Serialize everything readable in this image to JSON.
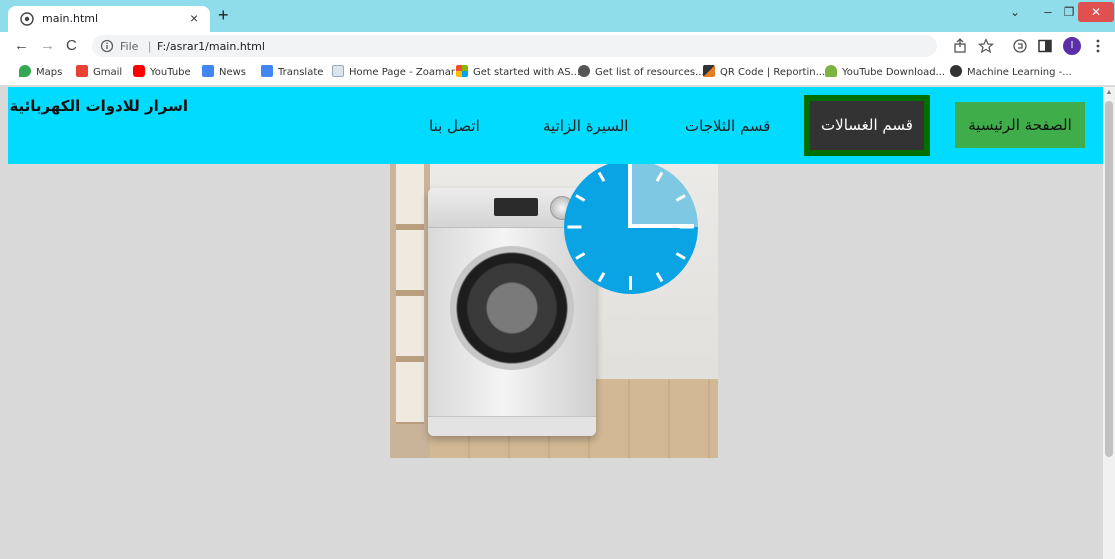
{
  "browser": {
    "tab_title": "main.html",
    "tab_close": "×",
    "new_tab": "+",
    "window_controls": {
      "search_tabs": "⌄",
      "minimize": "–",
      "restore": "❐",
      "close": "✕"
    },
    "nav": {
      "back": "←",
      "forward": "→",
      "reload": "C"
    },
    "omnibox": {
      "scheme_label": "File",
      "separator": "|",
      "url": "F:/asrar1/main.html"
    },
    "toolbar_icons": [
      "share-icon",
      "star-icon",
      "extensions-icon",
      "sidebar-icon",
      "menu-icon"
    ],
    "profile_initial": "I",
    "bookmarks": [
      {
        "label": "Maps",
        "icon": "maps-icon",
        "color": "#34a853"
      },
      {
        "label": "Gmail",
        "icon": "gmail-icon",
        "color": "#ea4335"
      },
      {
        "label": "YouTube",
        "icon": "youtube-icon",
        "color": "#ff0000"
      },
      {
        "label": "News",
        "icon": "news-icon",
        "color": "#4285f4"
      },
      {
        "label": "Translate",
        "icon": "translate-icon",
        "color": "#4285f4"
      },
      {
        "label": "Home Page - Zoamar",
        "icon": "page-icon",
        "color": "#9ab"
      },
      {
        "label": "Get started with AS...",
        "icon": "windows-icon",
        "color": "#f25022"
      },
      {
        "label": "Get list of resources...",
        "icon": "globe-icon",
        "color": "#555555"
      },
      {
        "label": "QR Code | Reportin...",
        "icon": "qr-icon",
        "color": "#e67e22"
      },
      {
        "label": "YouTube Download...",
        "icon": "android-icon",
        "color": "#7cb342"
      },
      {
        "label": "Machine Learning -...",
        "icon": "ml-icon",
        "color": "#333333"
      }
    ]
  },
  "site": {
    "brand": "اسرار للادوات الكهربائية",
    "nav": {
      "home": "الصفحة الرئيسية",
      "washers": "قسم الغسالات",
      "fridges": "قسم الثلاجات",
      "bio": "السيرة الزاتية",
      "contact": "اتصل بنا"
    },
    "colors": {
      "nav_bg": "#00dbff",
      "home_bg": "#3fae4a",
      "active_border": "#006f00",
      "active_bg": "#333333",
      "page_bg": "#d9d9d9"
    },
    "hero_image": "washing-machine-with-clock-image"
  }
}
